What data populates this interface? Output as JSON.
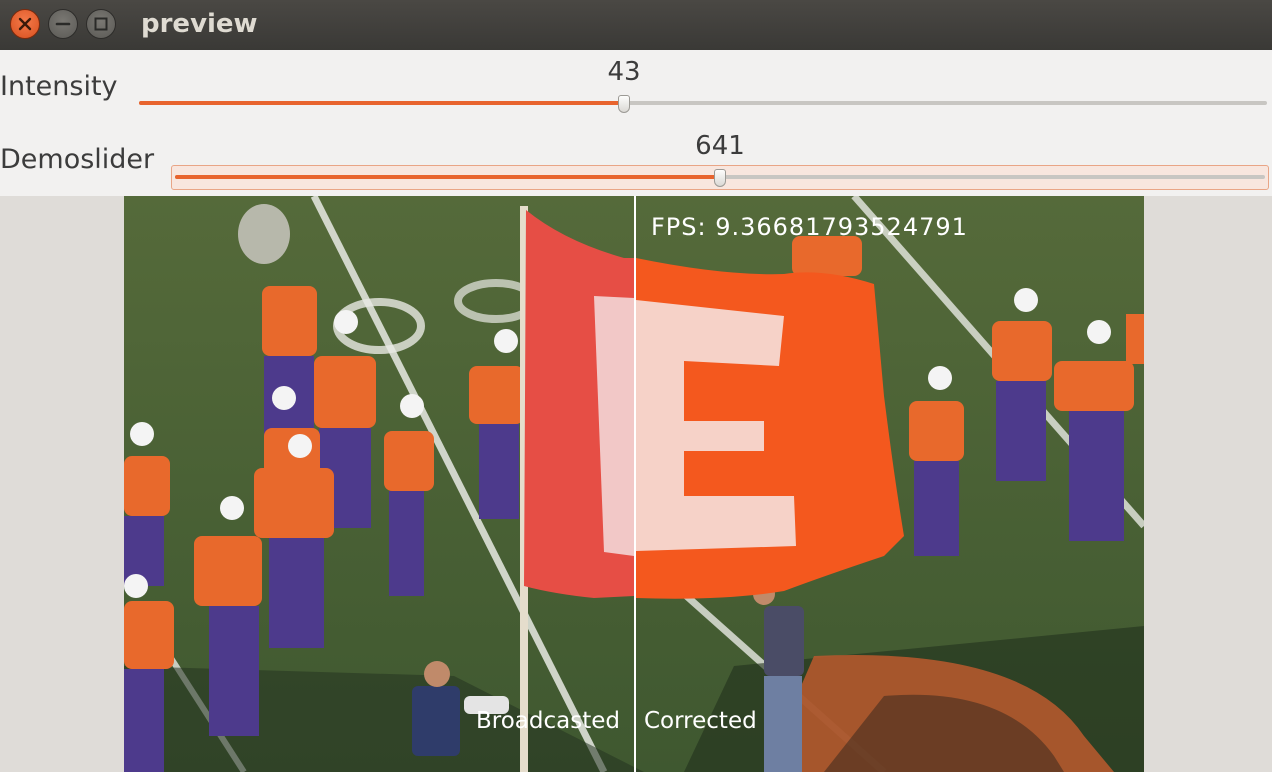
{
  "window": {
    "title": "preview",
    "buttons": [
      "close-icon",
      "minimize-icon",
      "maximize-icon"
    ]
  },
  "sliders": [
    {
      "label": "Intensity",
      "value": "43",
      "fraction": 0.43
    },
    {
      "label": "Demoslider",
      "value": "641",
      "fraction": 0.5
    }
  ],
  "video": {
    "fps_text": "FPS: 9.36681793524791",
    "left_label": "Broadcasted",
    "right_label": "Corrected"
  },
  "colors": {
    "accent": "#e8642e",
    "titlebar": "#3c3b37",
    "close": "#e95420"
  }
}
